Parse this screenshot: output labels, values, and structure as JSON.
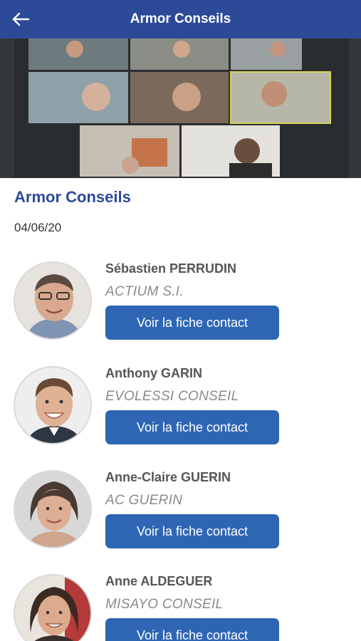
{
  "header": {
    "title": "Armor Conseils",
    "back_icon": "arrow-left-icon"
  },
  "colors": {
    "header_bg": "#2d4a99",
    "title_blue": "#2d4a99",
    "button_bg": "#2e66b4"
  },
  "event": {
    "title": "Armor Conseils",
    "date": "04/06/20"
  },
  "contacts": [
    {
      "name": "Sébastien PERRUDIN",
      "company": "ACTIUM S.I.",
      "button_label": "Voir la fiche contact"
    },
    {
      "name": "Anthony GARIN",
      "company": "EVOLESSI CONSEIL",
      "button_label": "Voir la fiche contact"
    },
    {
      "name": "Anne-Claire GUERIN",
      "company": "AC GUERIN",
      "button_label": "Voir la fiche contact"
    },
    {
      "name": "Anne ALDEGUER",
      "company": "MISAYO CONSEIL",
      "button_label": "Voir la fiche contact"
    }
  ]
}
